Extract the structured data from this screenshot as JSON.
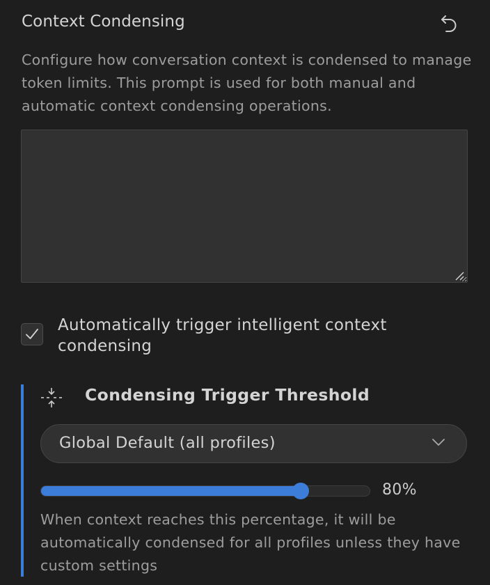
{
  "section": {
    "title": "Context Condensing",
    "reset_icon": "undo-icon",
    "description": "Configure how conversation context is condensed to manage token limits. This prompt is used for both manual and automatic context condensing operations."
  },
  "prompt": {
    "value": "",
    "placeholder": ""
  },
  "auto_condense": {
    "checked": true,
    "label": "Automatically trigger intelligent context condensing"
  },
  "threshold": {
    "icon": "fold-vertical-icon",
    "title": "Condensing Trigger Threshold",
    "profile_select": {
      "value": "Global Default (all profiles)",
      "icon": "chevron-down-icon"
    },
    "slider": {
      "value_percent": 80,
      "value_label": "80%"
    },
    "help": "When context reaches this percentage, it will be automatically condensed for all profiles unless they have custom settings"
  },
  "colors": {
    "background": "#1e1e1e",
    "accent": "#3b7dd8",
    "input_background": "#313131",
    "muted_text": "#9d9d9d"
  }
}
